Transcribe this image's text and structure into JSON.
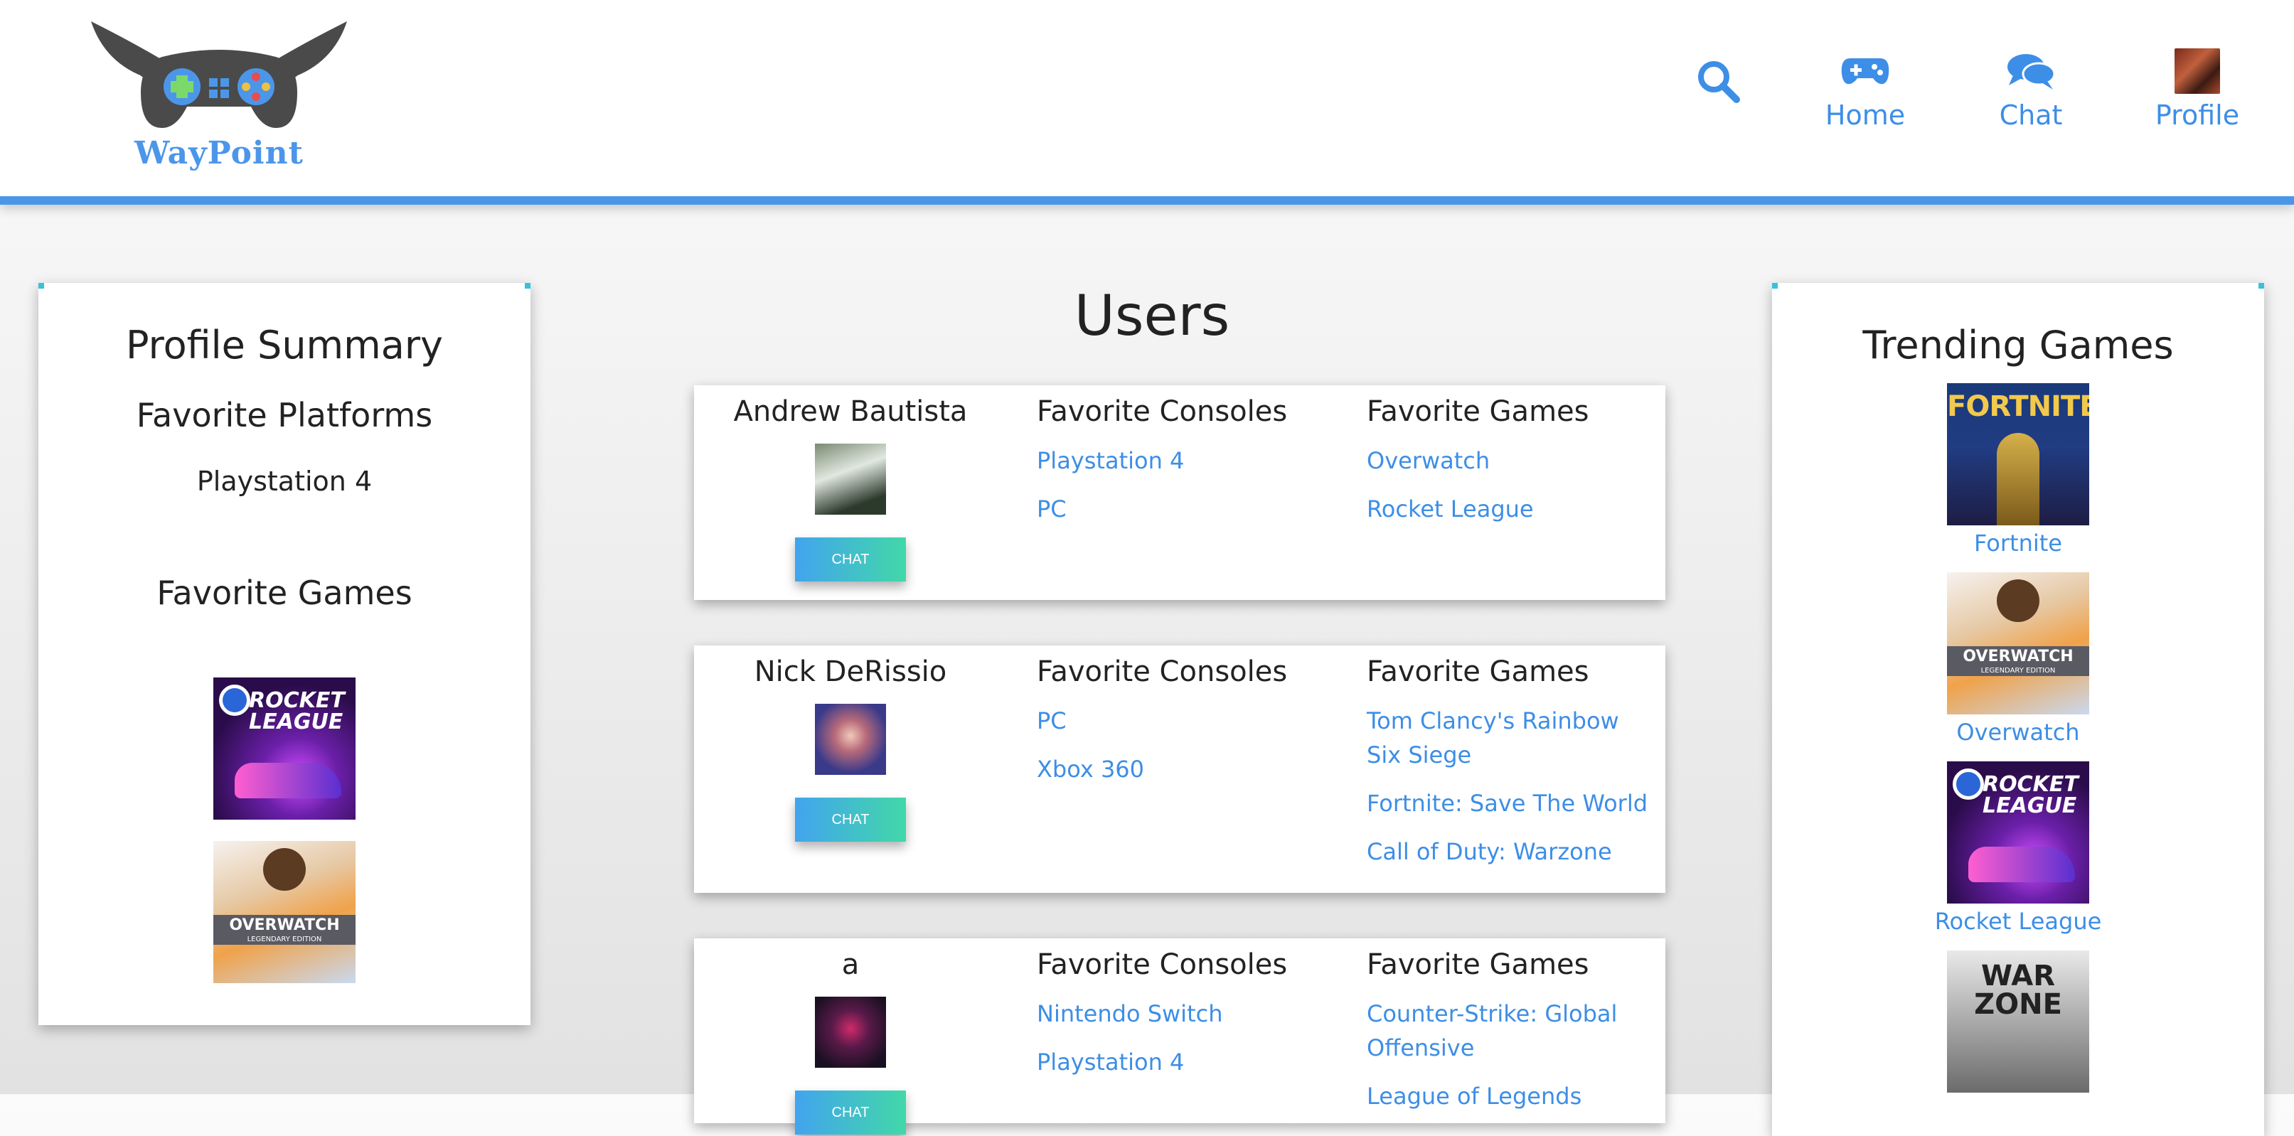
{
  "header": {
    "logo_text": "WayPoint",
    "nav": {
      "home": "Home",
      "chat": "Chat",
      "profile": "Profile"
    }
  },
  "profile_summary": {
    "title": "Profile Summary",
    "platforms_title": "Favorite Platforms",
    "platforms": [
      "Playstation 4"
    ],
    "games_title": "Favorite Games",
    "games": [
      "rocket-league",
      "overwatch"
    ]
  },
  "users": {
    "title": "Users",
    "consoles_header": "Favorite Consoles",
    "games_header": "Favorite Games",
    "chat_label": "CHAT",
    "list": [
      {
        "name": "Andrew Bautista",
        "consoles": [
          "Playstation 4",
          "PC"
        ],
        "games": [
          "Overwatch",
          "Rocket League"
        ]
      },
      {
        "name": "Nick DeRissio",
        "consoles": [
          "PC",
          "Xbox 360"
        ],
        "games": [
          "Tom Clancy's Rainbow Six Siege",
          "Fortnite: Save The World",
          "Call of Duty: Warzone"
        ]
      },
      {
        "name": "a",
        "consoles": [
          "Nintendo Switch",
          "Playstation 4"
        ],
        "games": [
          "Counter-Strike: Global Offensive",
          "League of Legends"
        ]
      }
    ]
  },
  "trending": {
    "title": "Trending Games",
    "games": [
      {
        "name": "Fortnite",
        "art_text": "FORTNITE"
      },
      {
        "name": "Overwatch",
        "art_text": "OVERWATCH"
      },
      {
        "name": "Rocket League",
        "art_text": "ROCKET LEAGUE"
      },
      {
        "name": "",
        "art_text": "WAR ZONE"
      }
    ]
  },
  "colors": {
    "accent": "#4c96ea",
    "link": "#3d8ee6",
    "chat_gradient_start": "#42a4ee",
    "chat_gradient_end": "#42d8a8"
  }
}
